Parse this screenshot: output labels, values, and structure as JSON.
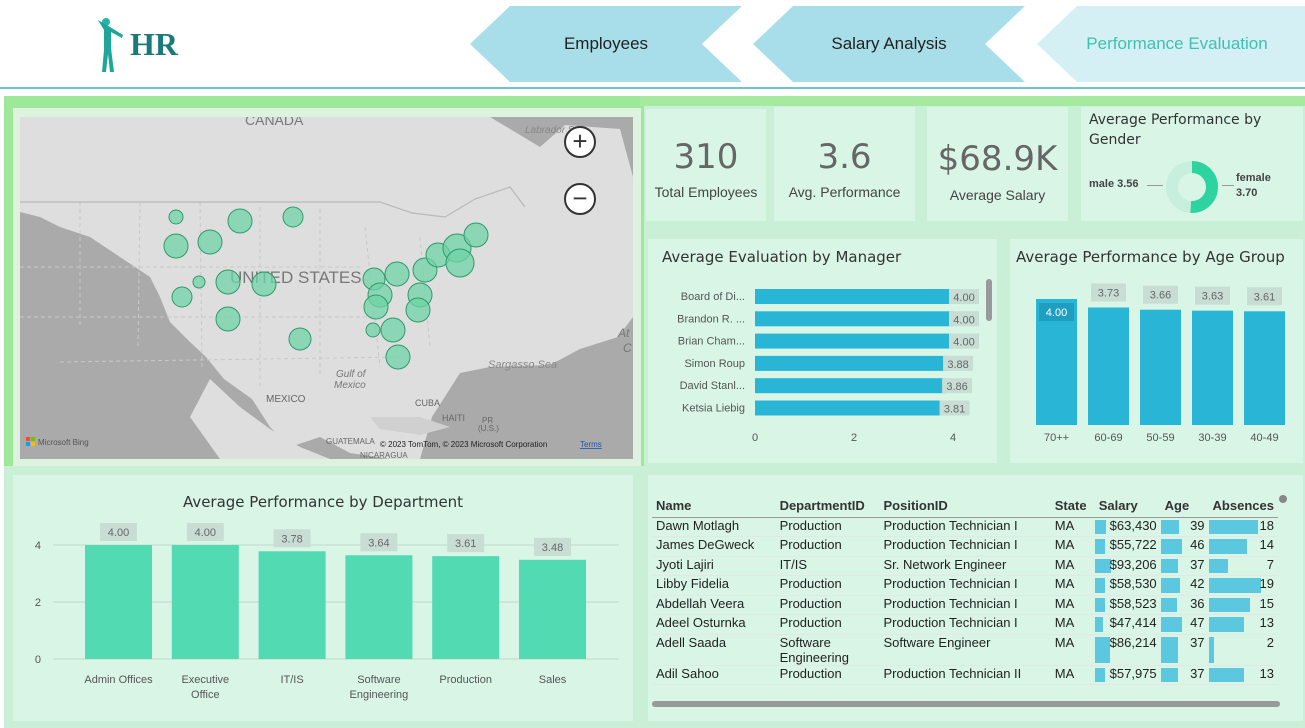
{
  "header": {
    "logo_text": "HR",
    "nav": [
      "Employees",
      "Salary Analysis",
      "Performance Evaluation"
    ]
  },
  "kpis": [
    {
      "value": "310",
      "label": "Total Employees"
    },
    {
      "value": "3.6",
      "label": "Avg. Performance"
    },
    {
      "value": "$68.9K",
      "label": "Average Salary"
    }
  ],
  "gender": {
    "title": "Average Performance by Gender",
    "male_label": "male 3.56",
    "female_label": "female",
    "female_value": "3.70",
    "male": 3.56,
    "female": 3.7
  },
  "map": {
    "labels": [
      "CANADA",
      "UNITED STATES",
      "MEXICO",
      "Gulf of",
      "Mexico",
      "Sargasso Sea",
      "Labrador Sea",
      "CUBA",
      "HAITI",
      "PR",
      "(U.S.)",
      "GUATEMALA",
      "NICARAGUA",
      "At",
      "C"
    ],
    "attribution": "© 2023 TomTom, © 2023 Microsoft Corporation",
    "terms": "Terms",
    "brand": "Microsoft Bing"
  },
  "manager_chart": {
    "title": "Average Evaluation by Manager"
  },
  "age_chart": {
    "title": "Average Performance by Age Group"
  },
  "dept_chart": {
    "title": "Average Performance by Department"
  },
  "chart_data": [
    {
      "type": "bar",
      "orientation": "horizontal",
      "title": "Average Evaluation by Manager",
      "categories": [
        "Board of Di...",
        "Brandon R. ...",
        "Brian Cham...",
        "Simon Roup",
        "David Stanl...",
        "Ketsia Liebig"
      ],
      "values": [
        4.0,
        4.0,
        4.0,
        3.88,
        3.86,
        3.81
      ],
      "labels": [
        "4.00",
        "4.00",
        "4.00",
        "3.88",
        "3.86",
        "3.81"
      ],
      "xlim": [
        0,
        4
      ],
      "xticks": [
        "0",
        "2",
        "4"
      ],
      "color": "#29b6d6"
    },
    {
      "type": "bar",
      "title": "Average Performance by Age Group",
      "categories": [
        "70++",
        "60-69",
        "50-59",
        "30-39",
        "40-49"
      ],
      "values": [
        4.0,
        3.73,
        3.66,
        3.63,
        3.61
      ],
      "labels": [
        "4.00",
        "3.73",
        "3.66",
        "3.63",
        "3.61"
      ],
      "color": "#29b6d6"
    },
    {
      "type": "bar",
      "title": "Average Performance by Department",
      "categories": [
        "Admin Offices",
        "Executive Office",
        "IT/IS",
        "Software Engineering",
        "Production",
        "Sales"
      ],
      "values": [
        4.0,
        4.0,
        3.78,
        3.64,
        3.61,
        3.48
      ],
      "labels": [
        "4.00",
        "4.00",
        "3.78",
        "3.64",
        "3.61",
        "3.48"
      ],
      "ylim": [
        0,
        4
      ],
      "yticks": [
        "0",
        "2",
        "4"
      ],
      "grid": true,
      "color": "#52dbb2"
    }
  ],
  "table": {
    "columns": [
      "Name",
      "DepartmentID",
      "PositionID",
      "State",
      "Salary",
      "Age",
      "Absences"
    ],
    "rows": [
      [
        "Dawn Motlagh",
        "Production",
        "Production Technician I",
        "MA",
        "$63,430",
        "39",
        "18"
      ],
      [
        "James DeGweck",
        "Production",
        "Production Technician I",
        "MA",
        "$55,722",
        "46",
        "14"
      ],
      [
        "Jyoti Lajiri",
        "IT/IS",
        "Sr. Network Engineer",
        "MA",
        "$93,206",
        "37",
        "7"
      ],
      [
        "Libby Fidelia",
        "Production",
        "Production Technician I",
        "MA",
        "$58,530",
        "42",
        "19"
      ],
      [
        "Abdellah Veera",
        "Production",
        "Production Technician I",
        "MA",
        "$58,523",
        "36",
        "15"
      ],
      [
        "Adeel Osturnka",
        "Production",
        "Production Technician I",
        "MA",
        "$47,414",
        "47",
        "13"
      ],
      [
        "Adell Saada",
        "Software Engineering",
        "Software Engineer",
        "MA",
        "$86,214",
        "37",
        "2"
      ],
      [
        "Adil Sahoo",
        "Production",
        "Production Technician II",
        "MA",
        "$57,975",
        "37",
        "13"
      ]
    ]
  }
}
